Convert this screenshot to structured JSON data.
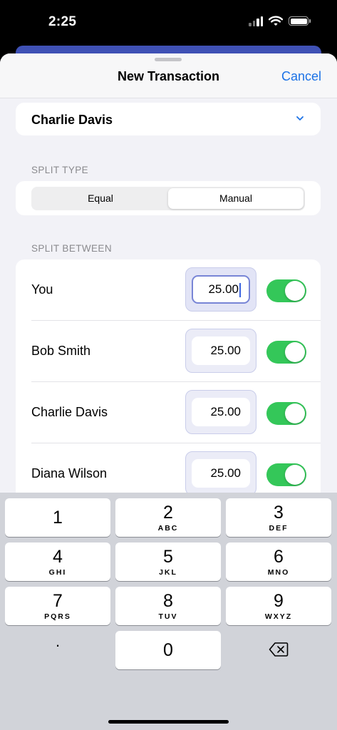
{
  "status_bar": {
    "time": "2:25"
  },
  "header": {
    "title": "New Transaction",
    "cancel_label": "Cancel"
  },
  "payer": {
    "name": "Charlie Davis"
  },
  "split_type": {
    "header": "SPLIT TYPE",
    "options": [
      "Equal",
      "Manual"
    ],
    "selected": "Manual"
  },
  "split_between": {
    "header": "SPLIT BETWEEN",
    "rows": [
      {
        "name": "You",
        "amount": "25.00",
        "included": true,
        "focused": true
      },
      {
        "name": "Bob Smith",
        "amount": "25.00",
        "included": true,
        "focused": false
      },
      {
        "name": "Charlie Davis",
        "amount": "25.00",
        "included": true,
        "focused": false
      },
      {
        "name": "Diana Wilson",
        "amount": "25.00",
        "included": true,
        "focused": false
      }
    ]
  },
  "keyboard": {
    "keys": [
      {
        "digit": "1",
        "letters": ""
      },
      {
        "digit": "2",
        "letters": "ABC"
      },
      {
        "digit": "3",
        "letters": "DEF"
      },
      {
        "digit": "4",
        "letters": "GHI"
      },
      {
        "digit": "5",
        "letters": "JKL"
      },
      {
        "digit": "6",
        "letters": "MNO"
      },
      {
        "digit": "7",
        "letters": "PQRS"
      },
      {
        "digit": "8",
        "letters": "TUV"
      },
      {
        "digit": "9",
        "letters": "WXYZ"
      },
      {
        "digit": "0",
        "letters": ""
      }
    ],
    "decimal_key": ".",
    "backspace_icon": "delete-left-icon"
  },
  "colors": {
    "accent": "#1c72e6",
    "toggle_on": "#34c759",
    "behind_card": "#3f51b5"
  }
}
